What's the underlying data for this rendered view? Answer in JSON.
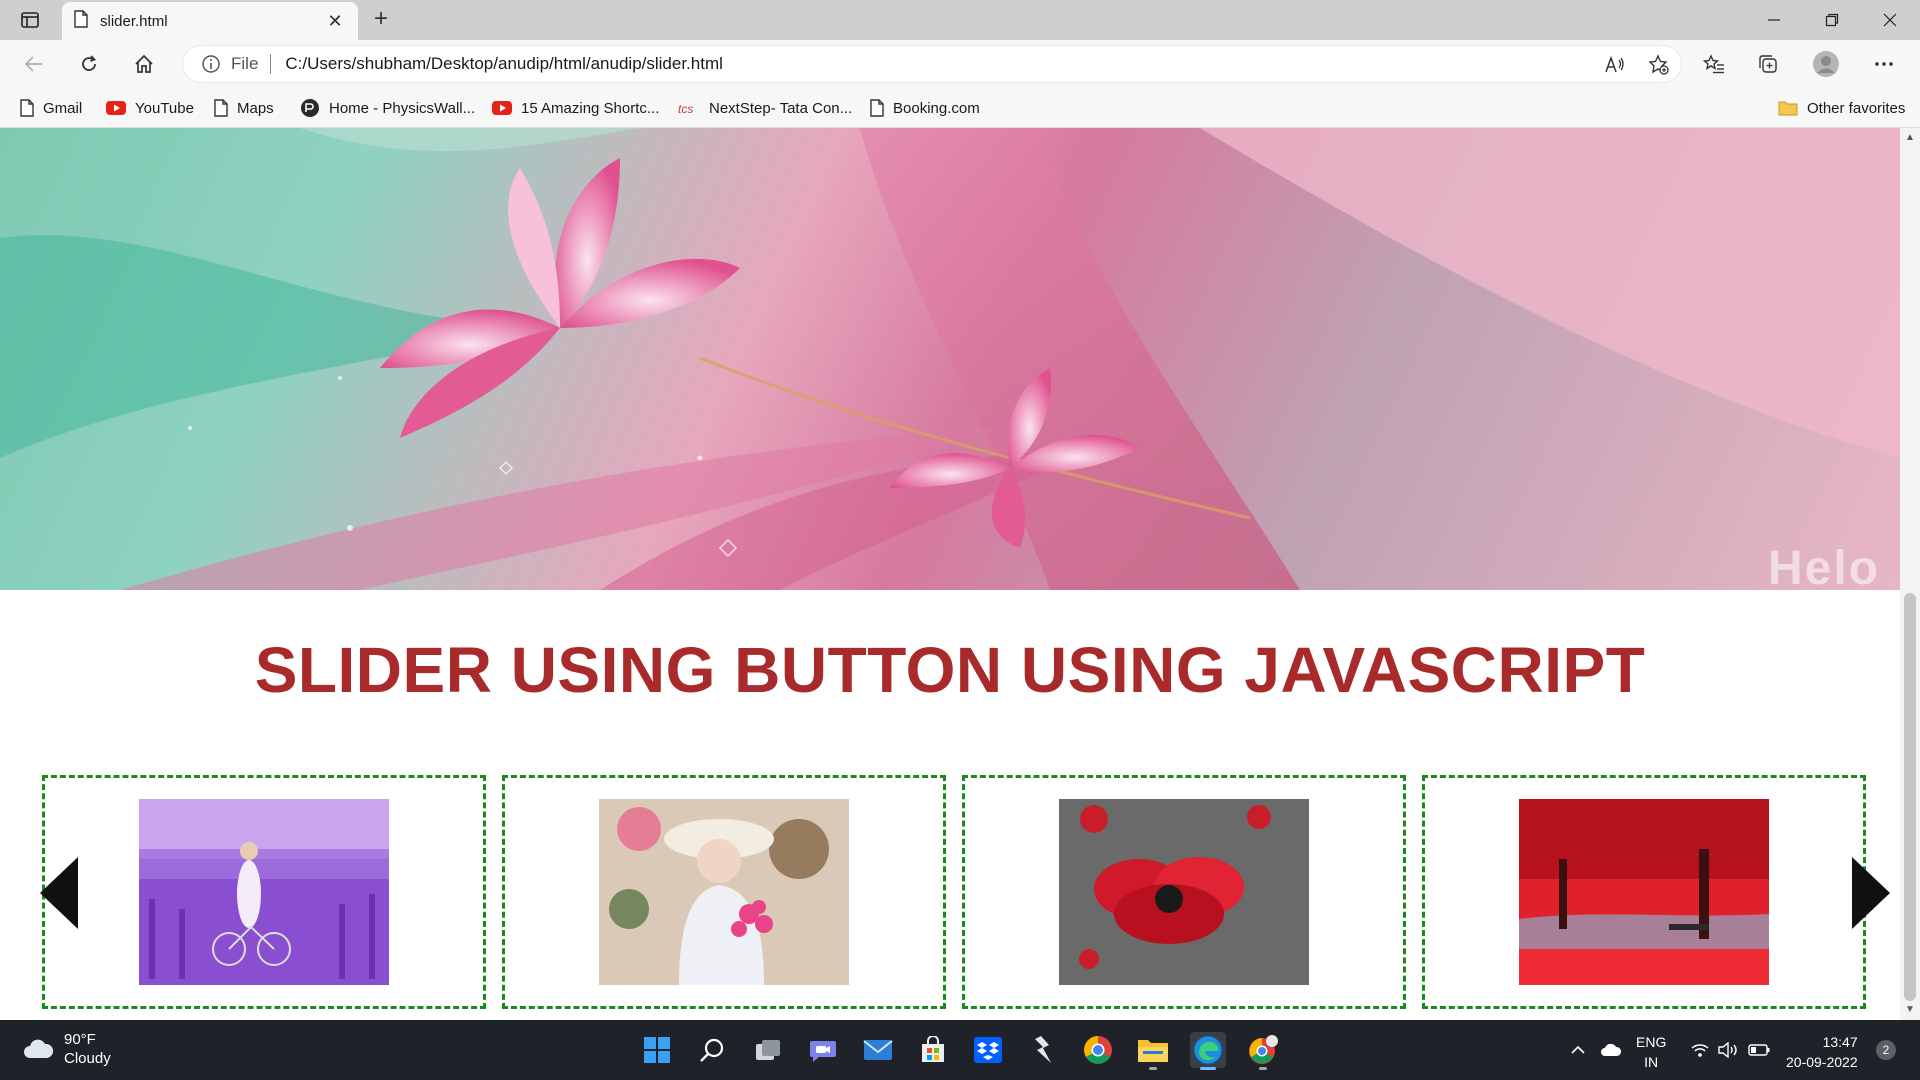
{
  "browser": {
    "tab_title": "slider.html",
    "address": {
      "scheme_label": "File",
      "url": "C:/Users/shubham/Desktop/anudip/html/anudip/slider.html"
    },
    "favorites": [
      {
        "label": "Gmail",
        "icon": "page-icon"
      },
      {
        "label": "YouTube",
        "icon": "youtube-icon"
      },
      {
        "label": "Maps",
        "icon": "page-icon"
      },
      {
        "label": "Home - PhysicsWall...",
        "icon": "physicswallah-icon"
      },
      {
        "label": "15 Amazing Shortc...",
        "icon": "youtube-icon"
      },
      {
        "label": "NextStep- Tata Con...",
        "icon": "tcs-icon"
      },
      {
        "label": "Booking.com",
        "icon": "page-icon"
      }
    ],
    "other_favorites": "Other favorites"
  },
  "page": {
    "heading": "SLIDER USING BUTTON USING JAVASCRIPT",
    "hero_watermark": "Helo",
    "slides": [
      {
        "description": "lavender field with bicycle"
      },
      {
        "description": "girl with hat and pink flowers"
      },
      {
        "description": "red poppy flower"
      },
      {
        "description": "red autumn park"
      }
    ],
    "colors": {
      "heading": "#a82a2a",
      "slide_border": "#1a8a1a"
    }
  },
  "taskbar": {
    "weather_temp": "90°F",
    "weather_desc": "Cloudy",
    "lang_line1": "ENG",
    "lang_line2": "IN",
    "time": "13:47",
    "date": "20-09-2022",
    "notification_count": "2"
  }
}
